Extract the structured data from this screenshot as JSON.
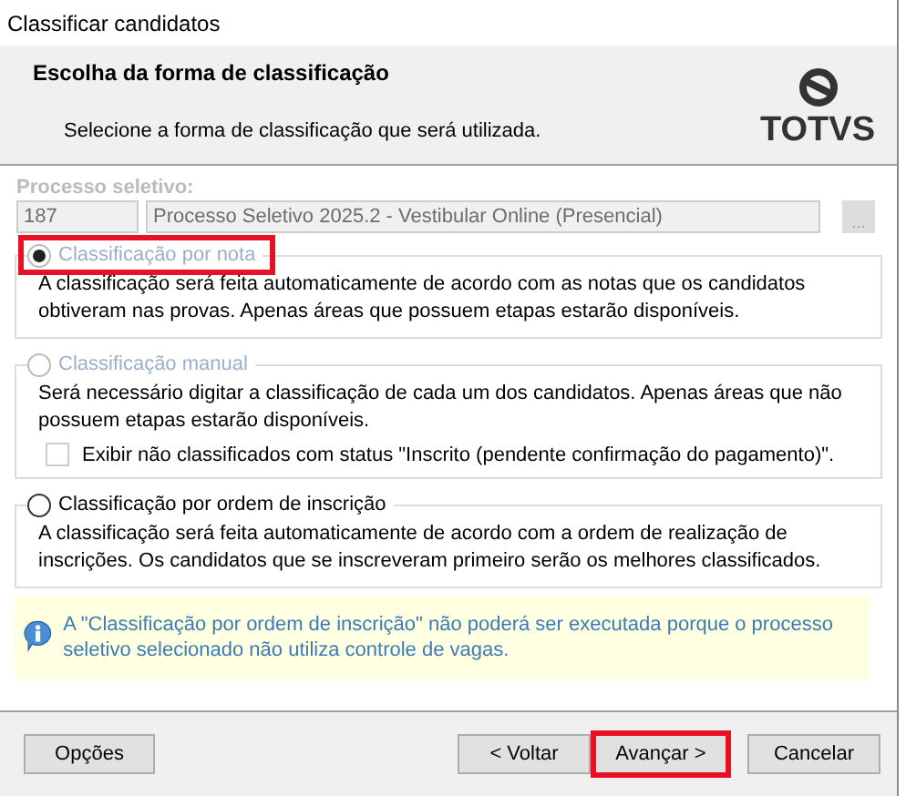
{
  "window": {
    "title": "Classificar candidatos"
  },
  "header": {
    "title": "Escolha da forma de classificação",
    "subtitle": "Selecione a forma de classificação que será utilizada.",
    "logo": "TOTVS"
  },
  "process": {
    "label": "Processo seletivo:",
    "code": "187",
    "name": "Processo Seletivo 2025.2 - Vestibular Online (Presencial)",
    "browse": "...",
    "disabled": true
  },
  "options": [
    {
      "label": "Classificação por nota",
      "selected": true,
      "disabled": true,
      "highlighted": true,
      "description": "A classificação será feita automaticamente de acordo com as notas que os candidatos obtiveram nas provas. Apenas áreas que possuem etapas estarão disponíveis."
    },
    {
      "label": "Classificação manual",
      "selected": false,
      "disabled": true,
      "highlighted": false,
      "description": "Será necessário digitar a classificação de cada um dos candidatos. Apenas áreas que não possuem etapas estarão disponíveis.",
      "checkbox": {
        "label": "Exibir não classificados com status \"Inscrito (pendente confirmação do pagamento)\".",
        "checked": false
      }
    },
    {
      "label": "Classificação por ordem de inscrição",
      "selected": false,
      "disabled": false,
      "highlighted": false,
      "description": "A classificação será feita automaticamente de acordo com a ordem de realização de inscrições. Os candidatos que se inscreveram primeiro serão os melhores classificados."
    }
  ],
  "info": {
    "text": "A \"Classificação por ordem de inscrição\" não poderá ser executada porque o processo seletivo selecionado não utiliza controle de vagas."
  },
  "buttons": [
    {
      "label": "Opções",
      "highlighted": false
    },
    {
      "label": "< Voltar",
      "highlighted": false
    },
    {
      "label": "Avançar >",
      "highlighted": true
    },
    {
      "label": "Cancelar",
      "highlighted": false
    }
  ]
}
